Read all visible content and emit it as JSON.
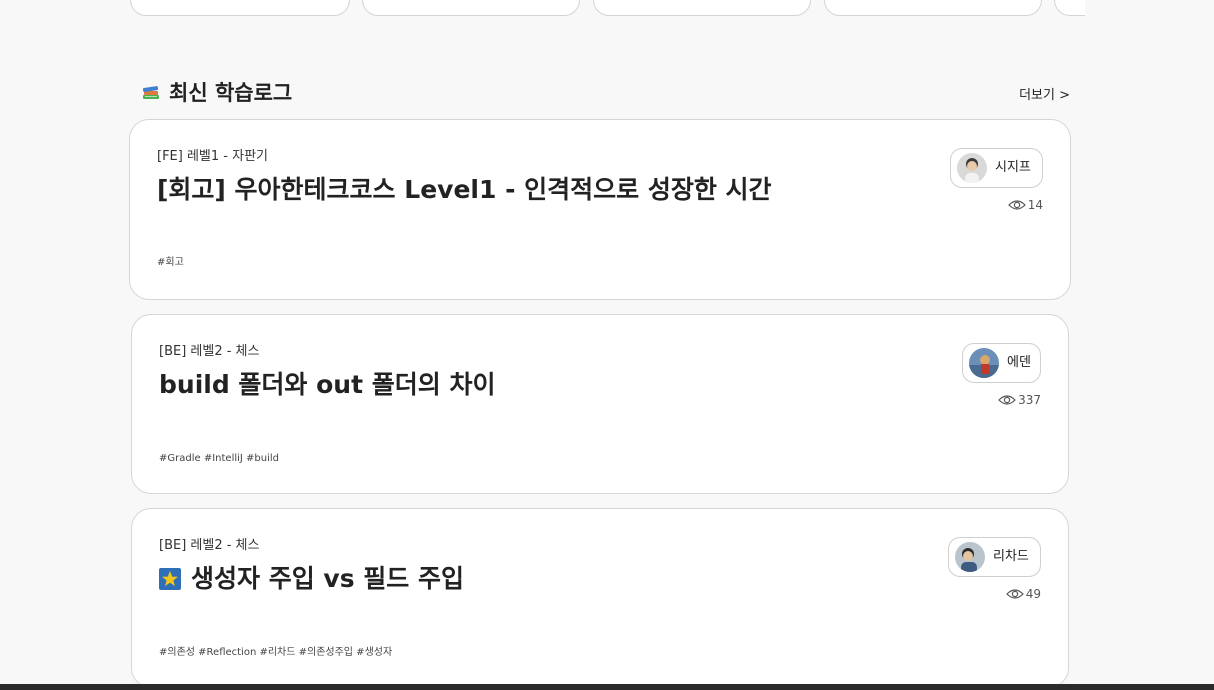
{
  "section": {
    "title": "최신 학습로그",
    "more": "더보기 >",
    "icon": "books-icon"
  },
  "posts": [
    {
      "course": "[FE] 레벨1 - 자판기",
      "title": "[회고] 우아한테크코스 Level1 - 인격적으로 성장한 시간",
      "tags": "#회고",
      "author": "시지프",
      "views": "14"
    },
    {
      "course": "[BE] 레벨2 - 체스",
      "title": "build 폴더와 out 폴더의 차이",
      "tags": "#Gradle #IntelliJ #build",
      "author": "에덴",
      "views": "337"
    },
    {
      "course": "[BE] 레벨2 - 체스",
      "title": "생성자 주입 vs 필드 주입",
      "title_icon": "star-icon",
      "tags": "#의존성 #Reflection #리차드 #의존성주입 #생성자",
      "author": "리차드",
      "views": "49"
    }
  ],
  "colors": {
    "background": "#f8f8f8",
    "card": "#ffffff",
    "border": "#d6d6d6",
    "text": "#222222"
  }
}
